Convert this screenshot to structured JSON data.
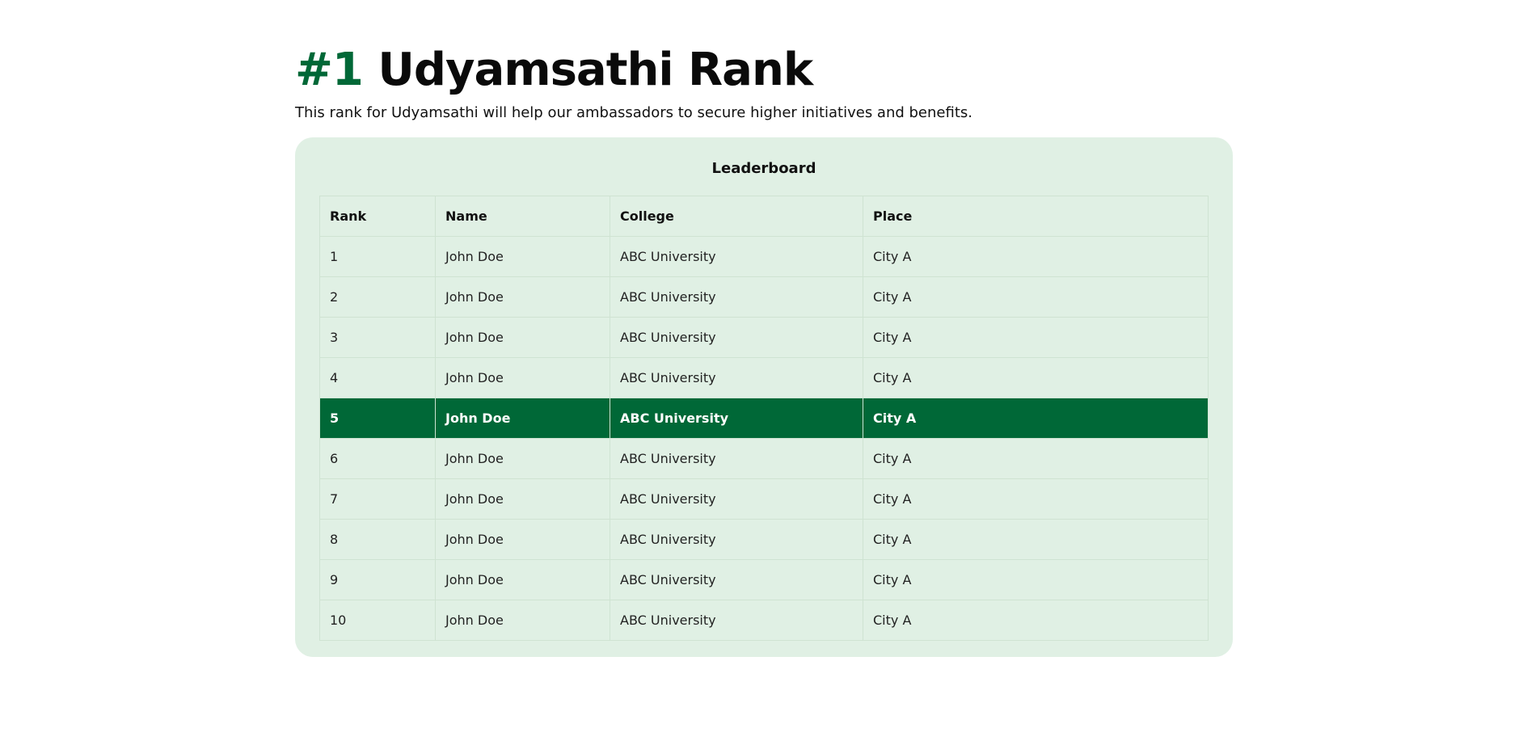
{
  "colors": {
    "accent": "#006837",
    "panel": "#e0f0e4"
  },
  "header": {
    "rank_number": "#1",
    "title": "Udyamsathi Rank",
    "subtitle": "This rank for Udyamsathi will help our ambassadors to secure higher initiatives and benefits."
  },
  "leaderboard": {
    "title": "Leaderboard",
    "columns": [
      "Rank",
      "Name",
      "College",
      "Place"
    ],
    "highlighted_rank": "5",
    "rows": [
      {
        "rank": "1",
        "name": "John Doe",
        "college": "ABC University",
        "place": "City A"
      },
      {
        "rank": "2",
        "name": "John Doe",
        "college": "ABC University",
        "place": "City A"
      },
      {
        "rank": "3",
        "name": "John Doe",
        "college": "ABC University",
        "place": "City A"
      },
      {
        "rank": "4",
        "name": "John Doe",
        "college": "ABC University",
        "place": "City A"
      },
      {
        "rank": "5",
        "name": "John Doe",
        "college": "ABC University",
        "place": "City A"
      },
      {
        "rank": "6",
        "name": "John Doe",
        "college": "ABC University",
        "place": "City A"
      },
      {
        "rank": "7",
        "name": "John Doe",
        "college": "ABC University",
        "place": "City A"
      },
      {
        "rank": "8",
        "name": "John Doe",
        "college": "ABC University",
        "place": "City A"
      },
      {
        "rank": "9",
        "name": "John Doe",
        "college": "ABC University",
        "place": "City A"
      },
      {
        "rank": "10",
        "name": "John Doe",
        "college": "ABC University",
        "place": "City A"
      }
    ]
  }
}
